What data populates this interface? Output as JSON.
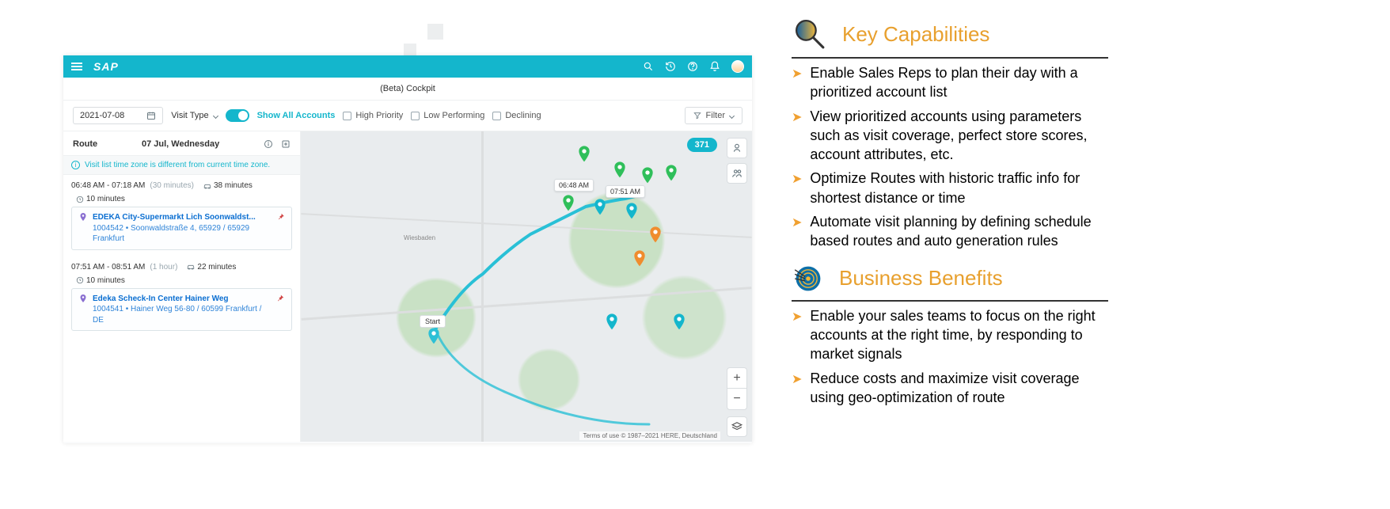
{
  "app": {
    "logo": "SAP",
    "page_title": "(Beta) Cockpit",
    "date_value": "2021-07-08",
    "visit_type_label": "Visit Type",
    "toggle_label": "Show All Accounts",
    "chk_high": "High Priority",
    "chk_low": "Low Performing",
    "chk_decl": "Declining",
    "filter_label": "Filter"
  },
  "side": {
    "route_label": "Route",
    "route_date": "07 Jul, Wednesday",
    "info_msg": "Visit list time zone is different from current time zone.",
    "items": [
      {
        "time": "06:48 AM - 07:18 AM",
        "dur": "(30 minutes)",
        "drive": "38 minutes",
        "extra": "10 minutes",
        "title": "EDEKA City-Supermarkt Lich Soonwaldst...",
        "sub": "1004542 • Soonwaldstraße 4, 65929 / 65929 Frankfurt"
      },
      {
        "time": "07:51 AM - 08:51 AM",
        "dur": "(1 hour)",
        "drive": "22 minutes",
        "extra": "10 minutes",
        "title": "Edeka Scheck-In Center Hainer Weg",
        "sub": "1004541 • Hainer Weg 56-80 / 60599 Frankfurt / DE"
      }
    ]
  },
  "map": {
    "count": "371",
    "label1": "06:48 AM",
    "label2": "07:51 AM",
    "start": "Start",
    "attrib": "Terms of use    © 1987–2021 HERE, Deutschland",
    "city1": "Wiesbaden"
  },
  "info": {
    "cap_title": "Key Capabilities",
    "caps": [
      "Enable Sales Reps to plan their day with a prioritized account list",
      "View prioritized accounts using parameters such as visit coverage, perfect store scores, account attributes, etc.",
      "Optimize Routes with historic traffic info for shortest distance or time",
      "Automate visit planning by defining schedule based routes and auto generation rules"
    ],
    "ben_title": "Business Benefits",
    "bens": [
      "Enable your sales teams to focus on the right accounts at the right time, by responding to market signals",
      "Reduce costs and maximize visit coverage using geo-optimization of route"
    ]
  }
}
